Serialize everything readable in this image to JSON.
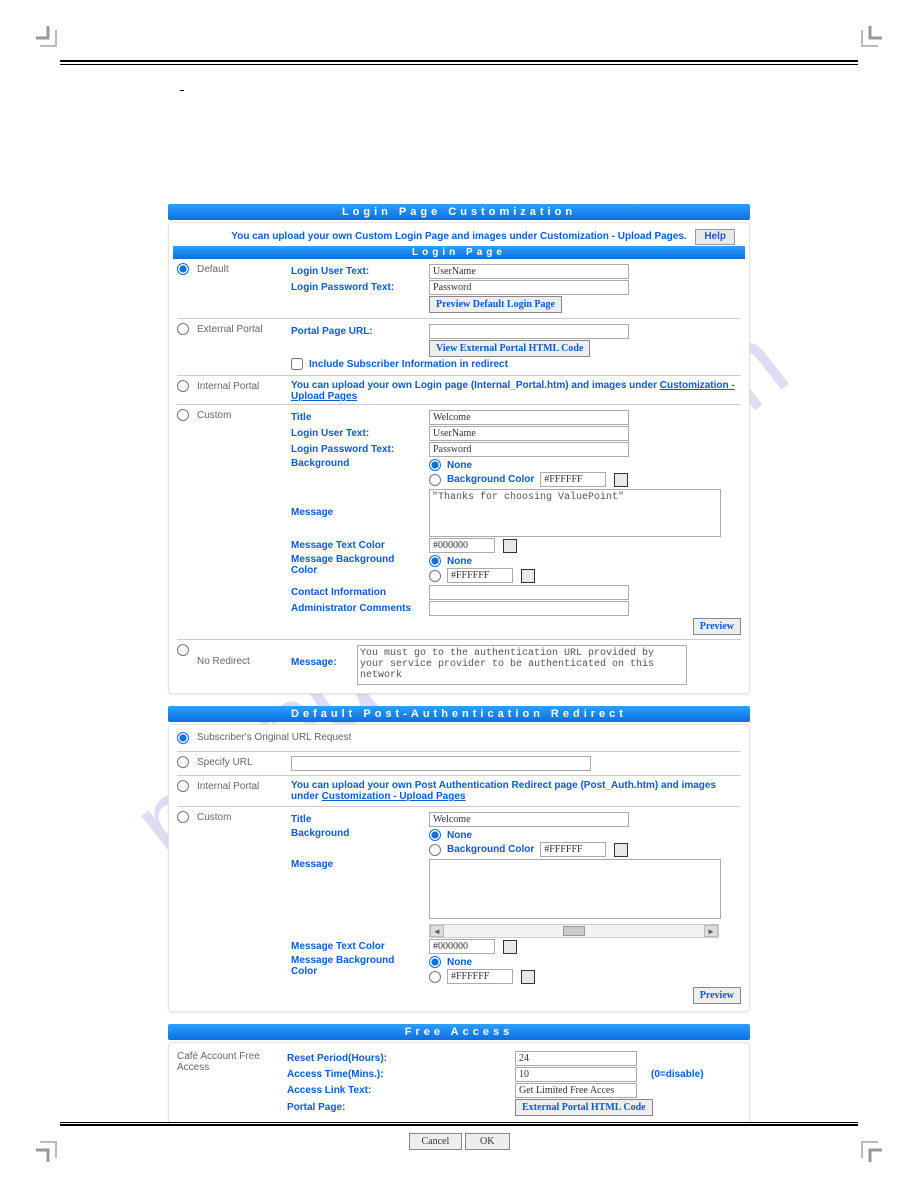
{
  "doc": {
    "section_title": ""
  },
  "watermark": "manualslive.com",
  "header": {
    "title": "Login Page Customization"
  },
  "top_panel": {
    "note": "You can upload your own Custom Login Page and images under Customization - Upload Pages.",
    "help": "Help",
    "subhead": "Login Page",
    "options": {
      "default": {
        "name": "Default",
        "login_user_text_label": "Login User Text:",
        "login_user_text_value": "UserName",
        "login_password_text_label": "Login Password Text:",
        "login_password_text_value": "Password",
        "preview_btn": "Preview Default Login Page"
      },
      "external": {
        "name": "External Portal",
        "portal_url_label": "Portal Page URL:",
        "portal_url_value": "",
        "view_btn": "View External Portal HTML Code",
        "include_label": "Include Subscriber Information in redirect"
      },
      "internal": {
        "name": "Internal Portal",
        "text_a": "You can upload your own Login page (Internal_Portal.htm) and images under ",
        "link": "Customization - Upload Pages"
      },
      "custom": {
        "name": "Custom",
        "title_label": "Title",
        "title_value": "Welcome",
        "login_user_text_label": "Login User Text:",
        "login_user_text_value": "UserName",
        "login_password_text_label": "Login Password Text:",
        "login_password_text_value": "Password",
        "background_label": "Background",
        "bg_none": "None",
        "bg_color": "Background Color",
        "bg_color_value": "#FFFFFF",
        "message_label": "Message",
        "message_value": "\"Thanks for choosing ValuePoint\"",
        "msg_text_color_label": "Message Text Color",
        "msg_text_color_value": "#000000",
        "msg_bg_color_label": "Message Background Color",
        "msg_bg_none": "None",
        "msg_bg_value": "#FFFFFF",
        "contact_label": "Contact Information",
        "contact_value": "",
        "admin_label": "Administrator Comments",
        "admin_value": "",
        "preview_btn": "Preview"
      },
      "noredirect": {
        "name": "No Redirect",
        "message_label": "Message:",
        "message_value": "You must go to the authentication URL provided by your service provider to be authenticated on this network"
      }
    }
  },
  "redirect": {
    "header": "Default Post-Authentication Redirect",
    "sub_original": "Subscriber's Original URL Request",
    "sub_specify": "Specify URL",
    "specify_value": "",
    "internal": {
      "name": "Internal Portal",
      "text_a": "You can upload your own Post Authentication Redirect page (Post_Auth.htm) and images under ",
      "link": "Customization - Upload Pages"
    },
    "custom": {
      "name": "Custom",
      "title_label": "Title",
      "title_value": "Welcome",
      "background_label": "Background",
      "bg_none": "None",
      "bg_color": "Background Color",
      "bg_color_value": "#FFFFFF",
      "message_label": "Message",
      "message_value": "",
      "msg_text_color_label": "Message Text Color",
      "msg_text_color_value": "#000000",
      "msg_bg_color_label": "Message Background Color",
      "msg_bg_none": "None",
      "msg_bg_value": "#FFFFFF",
      "preview_btn": "Preview"
    }
  },
  "free": {
    "header": "Free Access",
    "leftname": "Café Account Free Access",
    "reset_label": "Reset Period(Hours):",
    "reset_value": "24",
    "access_time_label": "Access Time(Mins.):",
    "access_time_value": "10",
    "zero_note": "(0=disable)",
    "access_link_label": "Access Link Text:",
    "access_link_value": "Get Limited Free Acces",
    "portal_label": "Portal Page:",
    "portal_btn": "External Portal HTML Code"
  },
  "buttons": {
    "cancel": "Cancel",
    "ok": "OK"
  }
}
